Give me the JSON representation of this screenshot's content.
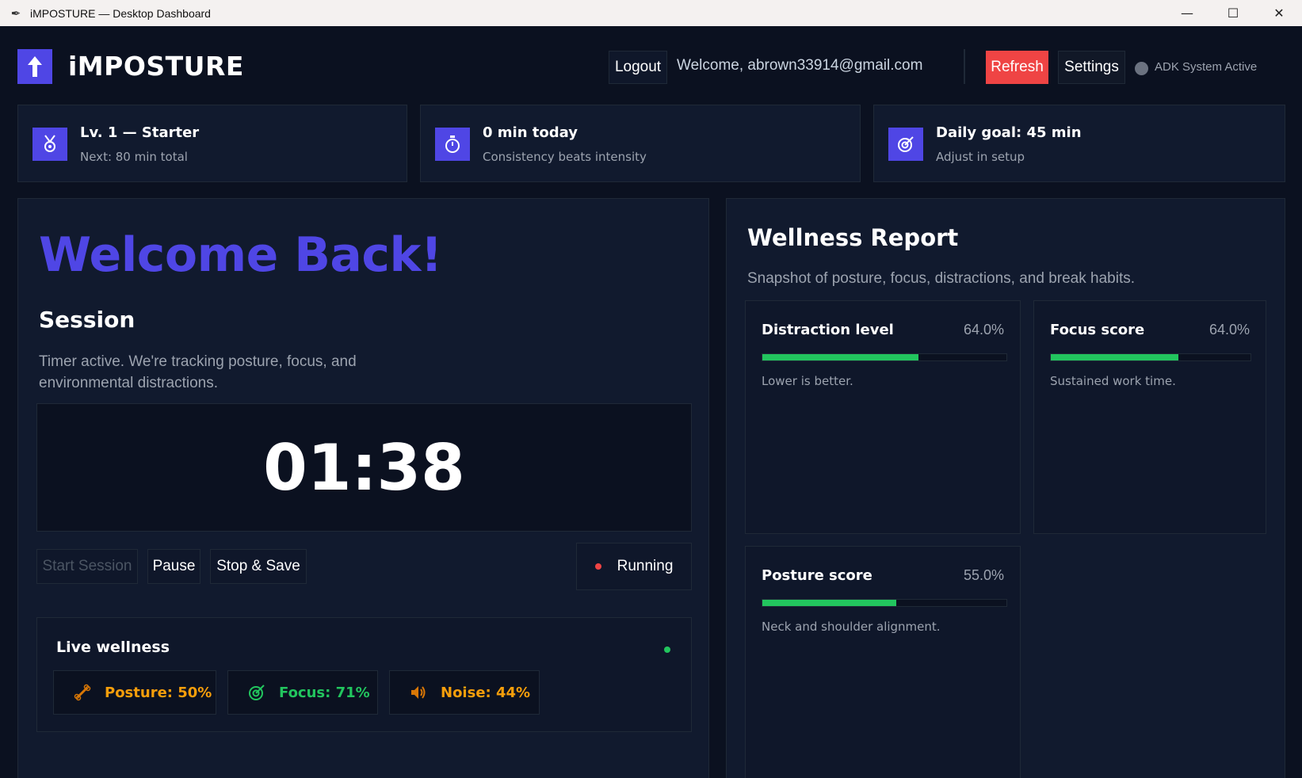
{
  "window": {
    "title": "iMPOSTURE — Desktop Dashboard",
    "minimize_glyph": "—",
    "maximize_glyph": "☐",
    "close_glyph": "✕"
  },
  "header": {
    "logo_text": "iMPOSTURE",
    "logout_label": "Logout",
    "welcome_text": "Welcome, abrown33914@gmail.com",
    "refresh_label": "Refresh",
    "settings_label": "Settings",
    "adk_status": "ADK System Active"
  },
  "stats": [
    {
      "title": "Lv. 1 — Starter",
      "subtitle": "Next: 80 min total",
      "icon": "medal-icon"
    },
    {
      "title": "0 min today",
      "subtitle": "Consistency beats intensity",
      "icon": "stopwatch-icon"
    },
    {
      "title": "Daily goal: 45 min",
      "subtitle": "Adjust in setup",
      "icon": "target-icon"
    }
  ],
  "session": {
    "welcome_heading": "Welcome Back!",
    "title": "Session",
    "description": "Timer active. We're tracking posture, focus, and environmental distractions.",
    "timer": "01:38",
    "start_label": "Start Session",
    "pause_label": "Pause",
    "stop_label": "Stop & Save",
    "status_label": "Running"
  },
  "live_wellness": {
    "title": "Live wellness",
    "posture": "Posture: 50%",
    "focus": "Focus: 71%",
    "noise": "Noise: 44%"
  },
  "wellness_report": {
    "title": "Wellness Report",
    "subtitle": "Snapshot of posture, focus, distractions, and break habits.",
    "metrics": [
      {
        "name": "Distraction level",
        "value": "64.0%",
        "level": 0.64,
        "note": "Lower is better."
      },
      {
        "name": "Focus score",
        "value": "64.0%",
        "level": 0.64,
        "note": "Sustained work time."
      },
      {
        "name": "Posture score",
        "value": "55.0%",
        "level": 0.55,
        "note": "Neck and shoulder alignment."
      }
    ]
  },
  "colors": {
    "background": "#0b1120",
    "card": "#111a2e",
    "accent": "#4f46e5",
    "danger": "#ef4444",
    "success": "#22c55e",
    "warning": "#f59e0b"
  }
}
